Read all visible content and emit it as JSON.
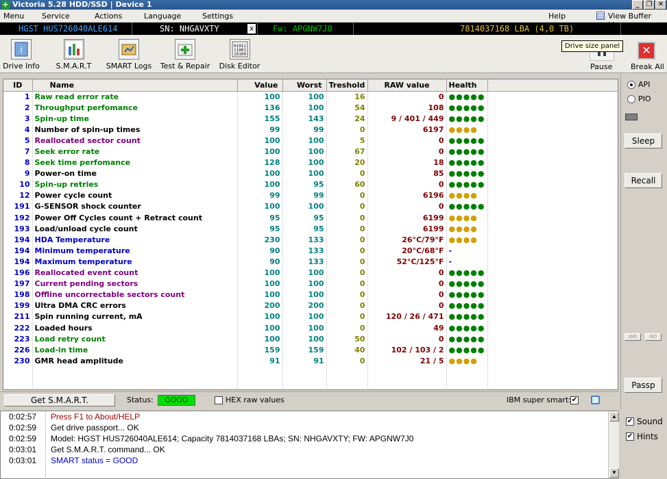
{
  "window": {
    "title": "Victoria 5.28 HDD/SSD | Device 1",
    "min": "_",
    "max": "❐",
    "close": "✕"
  },
  "menu": {
    "items": [
      "Menu",
      "Service",
      "Actions",
      "Language",
      "Settings"
    ],
    "help": "Help",
    "buffer": "View Buffer Live"
  },
  "drive": {
    "model": "HGST HUS726040ALE614",
    "sn": "SN: NHGAVXTY",
    "x": "x",
    "fw": "Fw: APGNW7J0",
    "lba": "7814037168 LBA (4,0 TB)"
  },
  "toolbar": {
    "drive_info": "Drive Info",
    "smart": "S.M.A.R.T",
    "smart_logs": "SMART Logs",
    "test_repair": "Test & Repair",
    "disk_editor": "Disk Editor",
    "pause": "Pause",
    "tooltip": "Drive size panel",
    "break_all": "Break All"
  },
  "grid": {
    "headers": [
      "ID",
      "Name",
      "Value",
      "Worst",
      "Treshold",
      "RAW value",
      "Health"
    ],
    "rows": [
      {
        "id": "1",
        "name": "Raw read error rate",
        "value": "100",
        "worst": "100",
        "thr": "16",
        "raw": "0",
        "health": "●●●●●"
      },
      {
        "id": "2",
        "name": "Throughput perfomance",
        "value": "136",
        "worst": "100",
        "thr": "54",
        "raw": "108",
        "health": "●●●●●"
      },
      {
        "id": "3",
        "name": "Spin-up time",
        "value": "155",
        "worst": "143",
        "thr": "24",
        "raw": "9 / 401 / 449",
        "health": "●●●●●"
      },
      {
        "id": "4",
        "name": "Number of spin-up times",
        "value": "99",
        "worst": "99",
        "thr": "0",
        "raw": "6197",
        "health": "●●●●"
      },
      {
        "id": "5",
        "name": "Reallocated sector count",
        "value": "100",
        "worst": "100",
        "thr": "5",
        "raw": "0",
        "health": "●●●●●"
      },
      {
        "id": "7",
        "name": "Seek error rate",
        "value": "100",
        "worst": "100",
        "thr": "67",
        "raw": "0",
        "health": "●●●●●"
      },
      {
        "id": "8",
        "name": "Seek time perfomance",
        "value": "128",
        "worst": "100",
        "thr": "20",
        "raw": "18",
        "health": "●●●●●"
      },
      {
        "id": "9",
        "name": "Power-on time",
        "value": "100",
        "worst": "100",
        "thr": "0",
        "raw": "85",
        "health": "●●●●●"
      },
      {
        "id": "10",
        "name": "Spin-up retries",
        "value": "100",
        "worst": "95",
        "thr": "60",
        "raw": "0",
        "health": "●●●●●"
      },
      {
        "id": "12",
        "name": "Power cycle count",
        "value": "99",
        "worst": "99",
        "thr": "0",
        "raw": "6196",
        "health": "●●●●"
      },
      {
        "id": "191",
        "name": "G-SENSOR shock counter",
        "value": "100",
        "worst": "100",
        "thr": "0",
        "raw": "0",
        "health": "●●●●●"
      },
      {
        "id": "192",
        "name": "Power Off Cycles count + Retract count",
        "value": "95",
        "worst": "95",
        "thr": "0",
        "raw": "6199",
        "health": "●●●●"
      },
      {
        "id": "193",
        "name": "Load/unload cycle count",
        "value": "95",
        "worst": "95",
        "thr": "0",
        "raw": "6199",
        "health": "●●●●"
      },
      {
        "id": "194",
        "name": "HDA Temperature",
        "value": "230",
        "worst": "133",
        "thr": "0",
        "raw": "26°C/79°F",
        "health": "●●●●"
      },
      {
        "id": "194",
        "name": "Minimum temperature",
        "value": "90",
        "worst": "133",
        "thr": "0",
        "raw": "20°C/68°F",
        "health": "-"
      },
      {
        "id": "194",
        "name": "Maximum temperature",
        "value": "90",
        "worst": "133",
        "thr": "0",
        "raw": "52°C/125°F",
        "health": "-"
      },
      {
        "id": "196",
        "name": "Reallocated event count",
        "value": "100",
        "worst": "100",
        "thr": "0",
        "raw": "0",
        "health": "●●●●●"
      },
      {
        "id": "197",
        "name": "Current pending sectors",
        "value": "100",
        "worst": "100",
        "thr": "0",
        "raw": "0",
        "health": "●●●●●"
      },
      {
        "id": "198",
        "name": "Offline uncorrectable sectors count",
        "value": "100",
        "worst": "100",
        "thr": "0",
        "raw": "0",
        "health": "●●●●●"
      },
      {
        "id": "199",
        "name": "Ultra DMA CRC errors",
        "value": "200",
        "worst": "200",
        "thr": "0",
        "raw": "0",
        "health": "●●●●●"
      },
      {
        "id": "211",
        "name": "Spin running current, mA",
        "value": "100",
        "worst": "100",
        "thr": "0",
        "raw": "120 / 26 / 471",
        "health": "●●●●●"
      },
      {
        "id": "222",
        "name": "Loaded hours",
        "value": "100",
        "worst": "100",
        "thr": "0",
        "raw": "49",
        "health": "●●●●●"
      },
      {
        "id": "223",
        "name": "Load retry count",
        "value": "100",
        "worst": "100",
        "thr": "50",
        "raw": "0",
        "health": "●●●●●"
      },
      {
        "id": "226",
        "name": "Load-in time",
        "value": "159",
        "worst": "159",
        "thr": "40",
        "raw": "102 / 103 / 2",
        "health": "●●●●●"
      },
      {
        "id": "230",
        "name": "GMR head amplitude",
        "value": "91",
        "worst": "91",
        "thr": "0",
        "raw": "21 / 5",
        "health": "●●●●"
      }
    ]
  },
  "status": {
    "get_smart": "Get S.M.A.R.T.",
    "status_label": "Status:",
    "status_value": "GOOD",
    "hex_raw": "HEX raw values",
    "ibm_smart": "IBM super smart:",
    "ibm_check": "✔"
  },
  "right": {
    "api": "API",
    "pio": "PIO",
    "sleep": "Sleep",
    "recall": "Recall",
    "wr": "WR",
    "rd": "RD",
    "passp": "Passp"
  },
  "log": [
    {
      "time": "0:02:57",
      "msg": "Press F1 to About/HELP"
    },
    {
      "time": "0:02:59",
      "msg": "Get drive passport... OK"
    },
    {
      "time": "0:02:59",
      "msg": "Model: HGST HUS726040ALE614; Capacity 7814037168 LBAs; SN: NHGAVXTY; FW: APGNW7J0"
    },
    {
      "time": "0:03:01",
      "msg": "Get S.M.A.R.T. command... OK"
    },
    {
      "time": "0:03:01",
      "msg": "SMART status = GOOD"
    }
  ],
  "options": {
    "sound": "Sound",
    "hints": "Hints",
    "check": "✔"
  },
  "scroll": {
    "up": "▲",
    "down": "▼"
  }
}
